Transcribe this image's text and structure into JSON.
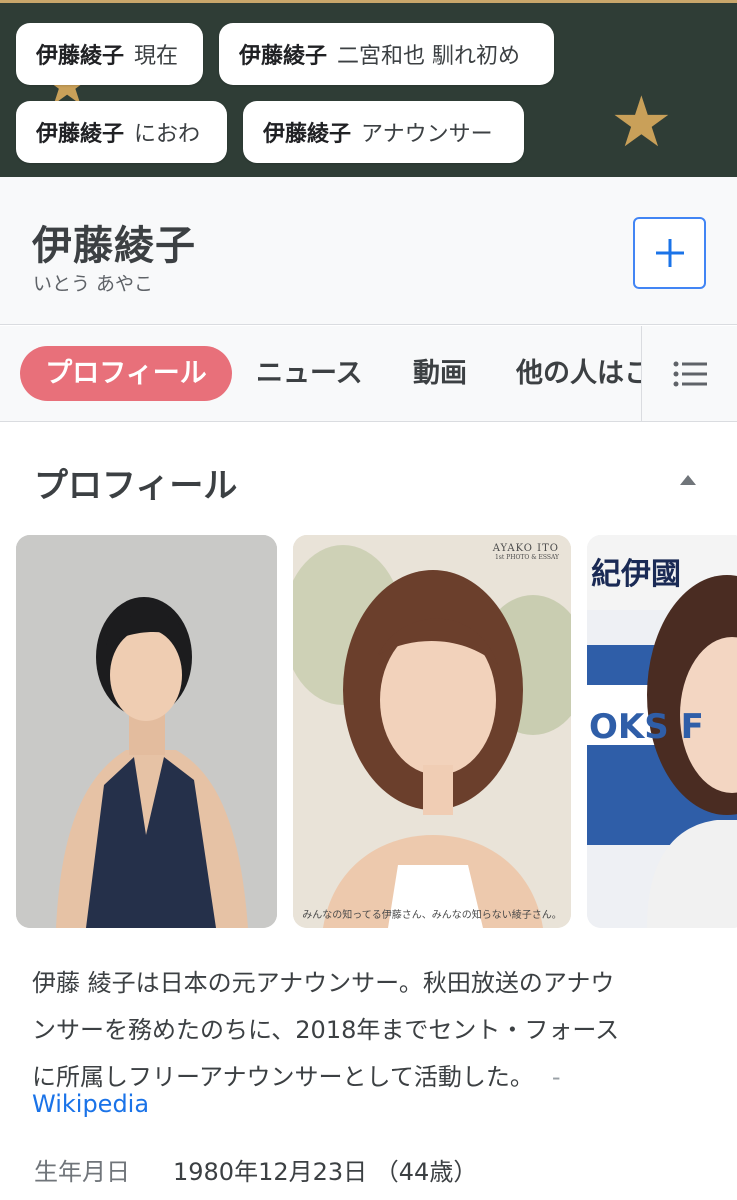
{
  "suggestions": {
    "chips": [
      {
        "bold": "伊藤綾子",
        "rest": "現在"
      },
      {
        "bold": "伊藤綾子",
        "rest": "二宮和也 馴れ初め"
      },
      {
        "bold": "伊藤綾子",
        "rest": "におわ"
      },
      {
        "bold": "伊藤綾子",
        "rest": "アナウンサー"
      }
    ],
    "band_color": "#2f3d36",
    "star_glyph": "★",
    "star_color": "#c9a059"
  },
  "entity": {
    "title": "伊藤綾子",
    "reading": "いとう あやこ",
    "add_icon": "plus-icon"
  },
  "tabs": {
    "items": [
      {
        "label": "プロフィール",
        "active": true
      },
      {
        "label": "ニュース"
      },
      {
        "label": "動画"
      },
      {
        "label": "他の人はこ"
      }
    ],
    "menu_icon": "list-menu-icon",
    "active_color": "#e8707a"
  },
  "profile": {
    "heading": "プロフィール",
    "collapse_icon": "chevron-up-icon",
    "photos": [
      {
        "alt": "portrait-woman-navy-dress"
      },
      {
        "alt": "photo-book-cover",
        "brand": "AYAKO ITO",
        "brand_sub": "1st PHOTO & ESSAY",
        "caption": "みんなの知ってる伊藤さん、みんなの知らない綾子さん。"
      },
      {
        "alt": "press-event-photo",
        "sign_text": "紀伊國",
        "sign_text2": "OKS F"
      }
    ],
    "description_lines": [
      "伊藤 綾子は日本の元アナウンサー。秋田放送のアナウ",
      "ンサーを務めたのちに、2018年までセント・フォース",
      "に所属しフリーアナウンサーとして活動した。"
    ],
    "description_separator": "-",
    "source_link": "Wikipedia",
    "facts": [
      {
        "label": "生年月日",
        "value": "1980年12月23日 （44歳）"
      }
    ]
  }
}
